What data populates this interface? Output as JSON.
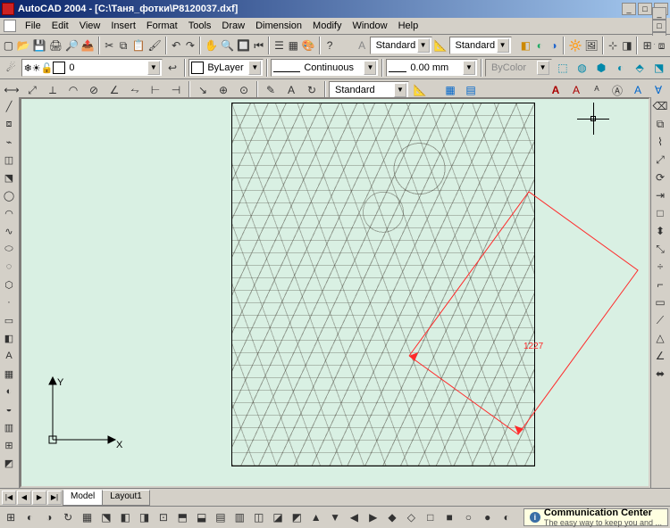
{
  "title": "AutoCAD 2004 - [C:\\Таня_фотки\\P8120037.dxf]",
  "menu": [
    "File",
    "Edit",
    "View",
    "Insert",
    "Format",
    "Tools",
    "Draw",
    "Dimension",
    "Modify",
    "Window",
    "Help"
  ],
  "winbtns": {
    "min": "_",
    "max": "□",
    "close": "×"
  },
  "row1": {
    "style_label_icon": "A",
    "text_style": "Standard",
    "dim_style": "Standard"
  },
  "row2": {
    "layer": "0",
    "color_name": "ByLayer",
    "linetype": "Continuous",
    "lineweight": "0.00 mm",
    "plotstyle": "ByColor"
  },
  "row3": {
    "table_style": "Standard",
    "annot_letter": "A"
  },
  "tabs": {
    "model": "Model",
    "layout1": "Layout1"
  },
  "navbtns": [
    "|◀",
    "◀",
    "▶",
    "▶|"
  ],
  "axes": {
    "x": "X",
    "y": "Y"
  },
  "dimension_value": "1227",
  "comm_center": "Communication Center",
  "comm_sub": "The easy way to keep you and ...",
  "left_tools": [
    "╱",
    "⧈",
    "⌁",
    "◫",
    "⬔",
    "◯",
    "◠",
    "∿",
    "⬭",
    "◌",
    "⬡",
    "·",
    "▭",
    "◧",
    "A",
    "▦",
    "◐",
    "◒",
    "▥",
    "⊞",
    "◩"
  ],
  "right_tools": [
    "⌫",
    "⧉",
    "⌇",
    "⤢",
    "⟳",
    "⇥",
    "□",
    "⬍",
    "⤡",
    "÷",
    "⌐",
    "▭",
    "⟋",
    "△",
    "∠",
    "⬌"
  ],
  "bottom_tools": [
    "⊞",
    "◐",
    "◑",
    "↻",
    "▦",
    "⬔",
    "◧",
    "◨",
    "⊡",
    "⬒",
    "⬓",
    "▤",
    "▥",
    "◫",
    "◪",
    "◩",
    "▲",
    "▼",
    "◀",
    "▶",
    "◆",
    "◇",
    "□",
    "■",
    "○",
    "●",
    "◐",
    "◑",
    "◒",
    "◓",
    "⬖",
    "⬗",
    "⬘",
    "⬙",
    "⬚"
  ]
}
